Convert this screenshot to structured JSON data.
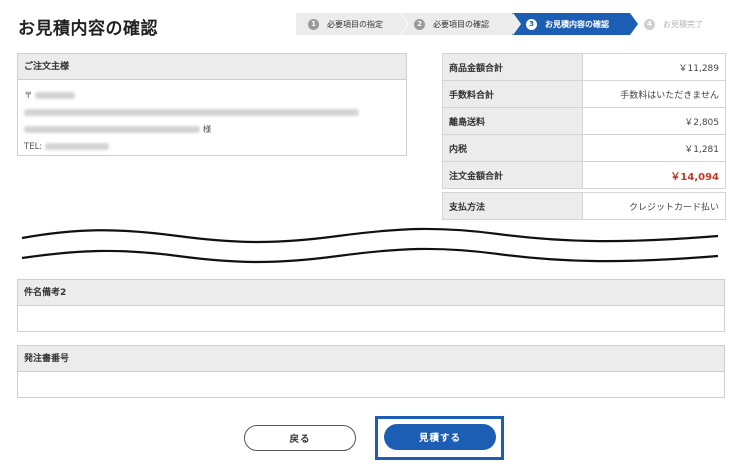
{
  "page": {
    "title": "お見積内容の確認"
  },
  "steps": [
    {
      "num": "1",
      "label": "必要項目の指定"
    },
    {
      "num": "2",
      "label": "必要項目の確認"
    },
    {
      "num": "3",
      "label": "お見積内容の確認"
    },
    {
      "num": "4",
      "label": "お見積完了"
    }
  ],
  "customer": {
    "heading": "ご注文主様",
    "postal_mark": "〒",
    "honorific": "様",
    "tel_label": "TEL:"
  },
  "summary": [
    {
      "label": "商品金額合計",
      "value": "￥11,289"
    },
    {
      "label": "手数料合計",
      "value": "手数料はいただきません"
    },
    {
      "label": "離島送料",
      "value": "￥2,805"
    },
    {
      "label": "内税",
      "value": "￥1,281"
    },
    {
      "label": "注文金額合計",
      "value": "￥14,094"
    },
    {
      "label": "支払方法",
      "value": "クレジットカード払い"
    }
  ],
  "fields": {
    "remark2_label": "件名備考2",
    "po_number_label": "発注書番号"
  },
  "buttons": {
    "back": "戻る",
    "submit": "見積する"
  },
  "colors": {
    "accent": "#1c5eb4",
    "total": "#c0392b",
    "header_bg": "#ececec"
  }
}
